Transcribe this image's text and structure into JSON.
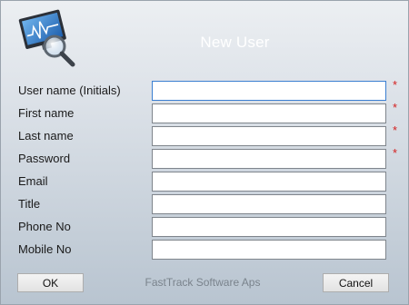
{
  "dialog": {
    "title": "New User",
    "footer": "FastTrack Software Aps",
    "ok_label": "OK",
    "cancel_label": "Cancel"
  },
  "fields": [
    {
      "label": "User name (Initials)",
      "value": "",
      "required": "*"
    },
    {
      "label": "First name",
      "value": "",
      "required": "*"
    },
    {
      "label": "Last name",
      "value": "",
      "required": "*"
    },
    {
      "label": "Password",
      "value": "",
      "required": "*"
    },
    {
      "label": "Email",
      "value": ""
    },
    {
      "label": "Title",
      "value": ""
    },
    {
      "label": "Phone No",
      "value": ""
    },
    {
      "label": "Mobile No",
      "value": ""
    }
  ],
  "icons": {
    "logo": "monitor-magnifier-icon"
  },
  "colors": {
    "required": "#d42020",
    "title_text": "#ffffff",
    "focus_border": "#3b7fd1"
  }
}
